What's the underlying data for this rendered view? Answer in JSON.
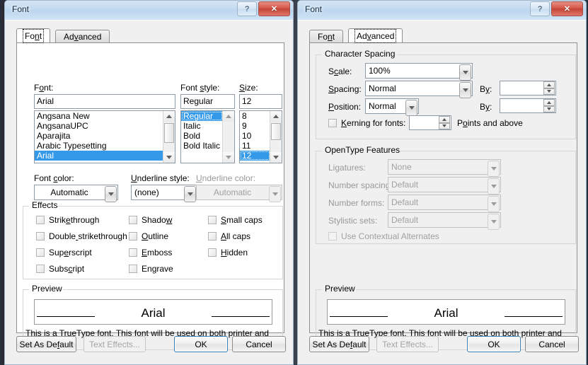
{
  "window": {
    "title": "Font",
    "help_label": "?",
    "close_label": "✕"
  },
  "tabs": {
    "font": "Font",
    "advanced": "Advanced"
  },
  "font_tab": {
    "labels": {
      "font": "Font:",
      "font_style": "Font style:",
      "size": "Size:",
      "font_color": "Font color:",
      "underline_style": "Underline style:",
      "underline_color": "Underline color:",
      "effects": "Effects",
      "preview": "Preview"
    },
    "font_value": "Arial",
    "font_list": [
      "Angsana New",
      "AngsanaUPC",
      "Aparajita",
      "Arabic Typesetting",
      "Arial"
    ],
    "font_selected": "Arial",
    "style_value": "Regular",
    "style_list": [
      "Regular",
      "Italic",
      "Bold",
      "Bold Italic"
    ],
    "style_selected": "Regular",
    "size_value": "12",
    "size_list": [
      "8",
      "9",
      "10",
      "11",
      "12"
    ],
    "size_selected": "12",
    "font_color_value": "Automatic",
    "underline_style_value": "(none)",
    "underline_color_value": "Automatic",
    "effects": [
      "Strikethrough",
      "Double strikethrough",
      "Superscript",
      "Subscript",
      "Shadow",
      "Outline",
      "Emboss",
      "Engrave",
      "Small caps",
      "All caps",
      "Hidden"
    ],
    "preview_text": "Arial",
    "preview_note": "This is a TrueType font. This font will be used on both printer and screen."
  },
  "advanced_tab": {
    "character_spacing": {
      "caption": "Character Spacing",
      "scale_label": "Scale:",
      "scale_value": "100%",
      "spacing_label": "Spacing:",
      "spacing_value": "Normal",
      "spacing_by_label": "By:",
      "spacing_by_value": "",
      "position_label": "Position:",
      "position_value": "Normal",
      "position_by_label": "By:",
      "position_by_value": "",
      "kerning_label": "Kerning for fonts:",
      "kerning_value": "",
      "kerning_suffix": "Points and above"
    },
    "opentype": {
      "caption": "OpenType Features",
      "ligatures_label": "Ligatures:",
      "ligatures_value": "None",
      "number_spacing_label": "Number spacing:",
      "number_spacing_value": "Default",
      "number_forms_label": "Number forms:",
      "number_forms_value": "Default",
      "stylistic_sets_label": "Stylistic sets:",
      "stylistic_sets_value": "Default",
      "contextual_alternates_label": "Use Contextual Alternates"
    },
    "preview_caption": "Preview",
    "preview_text": "Arial",
    "preview_note": "This is a TrueType font. This font will be used on both printer and screen."
  },
  "buttons": {
    "set_as_default": "Set As Default",
    "text_effects": "Text Effects...",
    "ok": "OK",
    "cancel": "Cancel"
  },
  "colors": {
    "selection_blue": "#3399e8",
    "titlebar_blue": "#c3daf0",
    "close_red": "#c54436",
    "default_button_border": "#3c7fb1"
  }
}
